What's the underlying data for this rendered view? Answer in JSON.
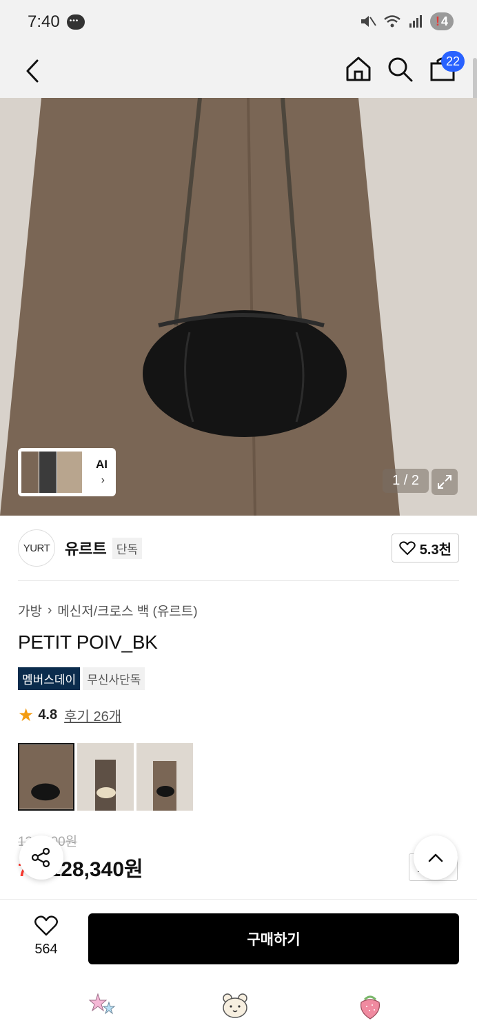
{
  "status_bar": {
    "time": "7:40",
    "battery": "4"
  },
  "header": {
    "cart_count": "22"
  },
  "gallery": {
    "counter": "1 / 2",
    "ai_label": "AI"
  },
  "brand": {
    "logo_text": "YURT",
    "name": "유르트",
    "tag": "단독",
    "likes": "5.3천"
  },
  "product": {
    "breadcrumb": [
      "가방",
      "메신저/크로스 백 (유르트)"
    ],
    "title": "PETIT POIV_BK",
    "tags": [
      "멤버스데이",
      "무신사단독"
    ],
    "rating": "4.8",
    "reviews_label": "후기 26개",
    "original_price": "139,000원",
    "discount": "7%",
    "sale_price": "128,340원",
    "coupon_label": "쿠폰"
  },
  "bottom": {
    "wish_count": "564",
    "buy_label": "구매하기"
  },
  "colors": {
    "buy_button": "#000000",
    "member_tag": "#0b2c4d",
    "cart_badge": "#2962ff",
    "star": "#f39c12"
  }
}
